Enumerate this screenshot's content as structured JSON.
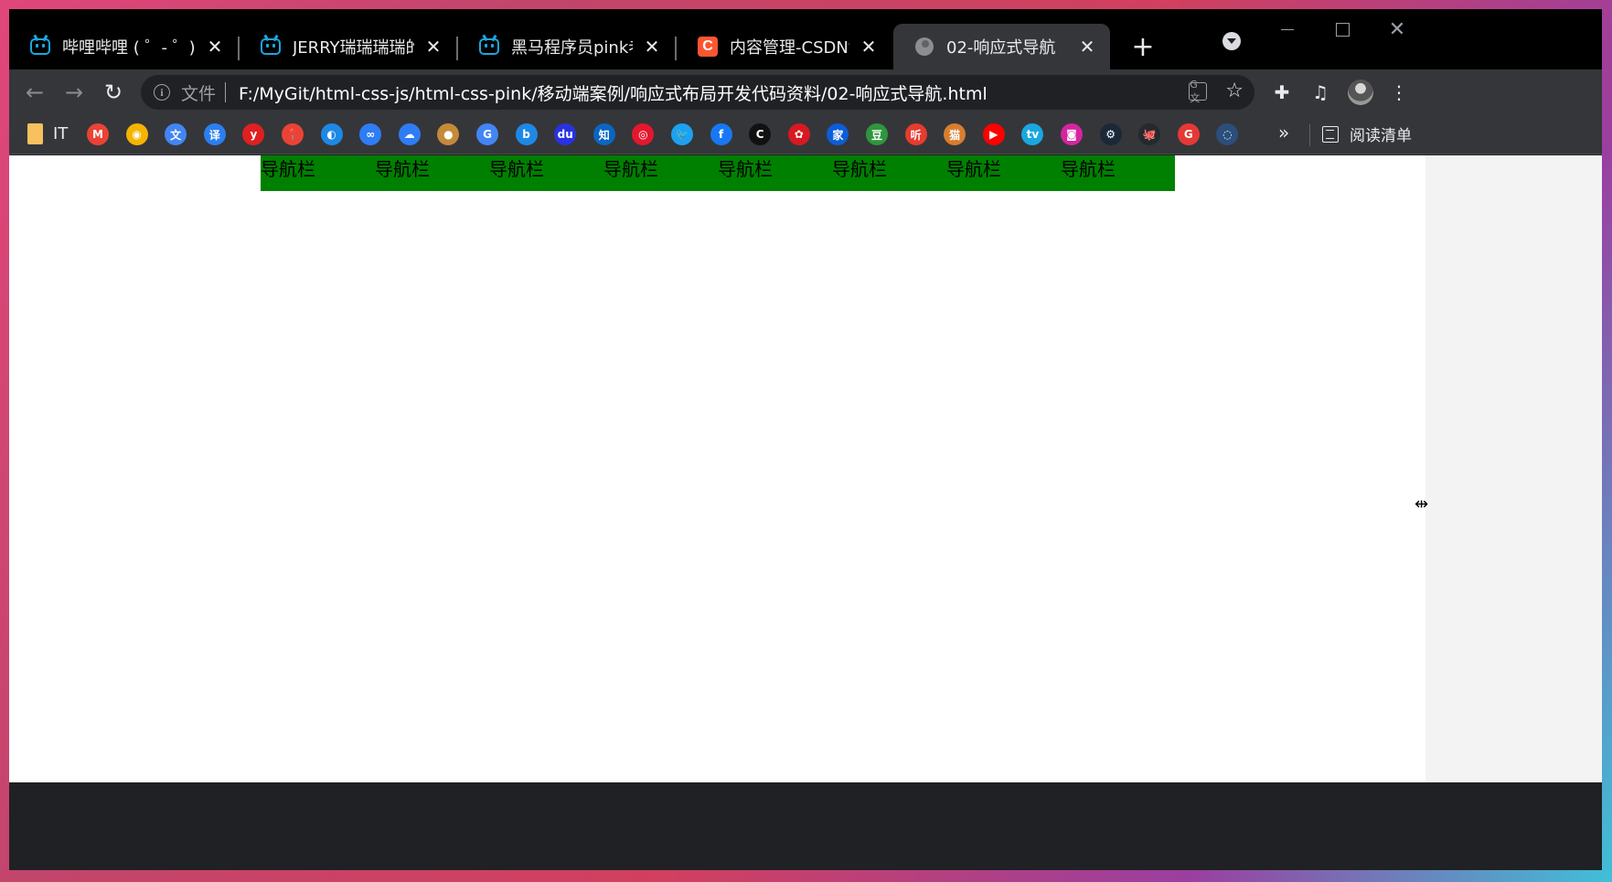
{
  "tabs": [
    {
      "title": "哔哩哔哩 ( ゜- ゜)つロ",
      "icon": "bilibili-icon"
    },
    {
      "title": "JERRY瑞瑞瑞瑞的个人",
      "icon": "bilibili-icon"
    },
    {
      "title": "黑马程序员pink老师前",
      "icon": "bilibili-icon"
    },
    {
      "title": "内容管理-CSDN博客",
      "icon": "csdn-icon"
    },
    {
      "title": "02-响应式导航",
      "icon": "globe-icon",
      "active": true
    }
  ],
  "toolbar": {
    "file_label": "文件",
    "url": "F:/MyGit/html-css-js/html-css-pink/移动端案例/响应式布局开发代码资料/02-响应式导航.html"
  },
  "bookmarks": {
    "folder_label": "IT",
    "reading_list_label": "阅读清单",
    "more_label": "»",
    "icons": [
      {
        "name": "gmail-icon",
        "color": "#ea4335",
        "glyph": "M"
      },
      {
        "name": "chrome-icon",
        "color": "#f4b400",
        "glyph": "◉"
      },
      {
        "name": "google-translate-icon",
        "color": "#4285f4",
        "glyph": "文"
      },
      {
        "name": "youdao-translate-icon",
        "color": "#2a7ef0",
        "glyph": "译"
      },
      {
        "name": "yinxiang-icon",
        "color": "#e02020",
        "glyph": "y"
      },
      {
        "name": "map-pin-icon",
        "color": "#ea4335",
        "glyph": "📍"
      },
      {
        "name": "browser-globe-icon",
        "color": "#1e88e5",
        "glyph": "◐"
      },
      {
        "name": "baidu-cloud-icon",
        "color": "#2e7cf6",
        "glyph": "∞"
      },
      {
        "name": "cloud-icon",
        "color": "#2e7cf6",
        "glyph": "☁"
      },
      {
        "name": "acorn-icon",
        "color": "#c48a3a",
        "glyph": "●"
      },
      {
        "name": "google-icon",
        "color": "#4285f4",
        "glyph": "G"
      },
      {
        "name": "bing-icon",
        "color": "#1e88e5",
        "glyph": "b"
      },
      {
        "name": "baidu-icon",
        "color": "#2932e1",
        "glyph": "du"
      },
      {
        "name": "zhihu-icon",
        "color": "#0a66c2",
        "glyph": "知"
      },
      {
        "name": "weibo-icon",
        "color": "#e6162d",
        "glyph": "◎"
      },
      {
        "name": "twitter-icon",
        "color": "#1da1f2",
        "glyph": "🐦"
      },
      {
        "name": "facebook-icon",
        "color": "#1877f2",
        "glyph": "f"
      },
      {
        "name": "c-icon",
        "color": "#111111",
        "glyph": "C"
      },
      {
        "name": "huawei-icon",
        "color": "#d71921",
        "glyph": "✿"
      },
      {
        "name": "jia-icon",
        "color": "#0b5ed7",
        "glyph": "家"
      },
      {
        "name": "douban-icon",
        "color": "#2e963d",
        "glyph": "豆"
      },
      {
        "name": "ting-icon",
        "color": "#e63b2e",
        "glyph": "听"
      },
      {
        "name": "cat-icon",
        "color": "#d97d2e",
        "glyph": "猫"
      },
      {
        "name": "youtube-icon",
        "color": "#ff0000",
        "glyph": "▶"
      },
      {
        "name": "bilibili-bookmark-icon",
        "color": "#1aa7e0",
        "glyph": "tv"
      },
      {
        "name": "instagram-icon",
        "color": "#d6249f",
        "glyph": "◙"
      },
      {
        "name": "steam-icon",
        "color": "#1b2838",
        "glyph": "⚙"
      },
      {
        "name": "github-icon",
        "color": "#24292e",
        "glyph": "🐙"
      },
      {
        "name": "g-red-icon",
        "color": "#e53935",
        "glyph": "G"
      },
      {
        "name": "faded-icon",
        "color": "#2b4f7a",
        "glyph": "◌"
      }
    ]
  },
  "page": {
    "nav_items": [
      "导航栏",
      "导航栏",
      "导航栏",
      "导航栏",
      "导航栏",
      "导航栏",
      "导航栏",
      "导航栏"
    ],
    "nav_color": "#008000"
  }
}
